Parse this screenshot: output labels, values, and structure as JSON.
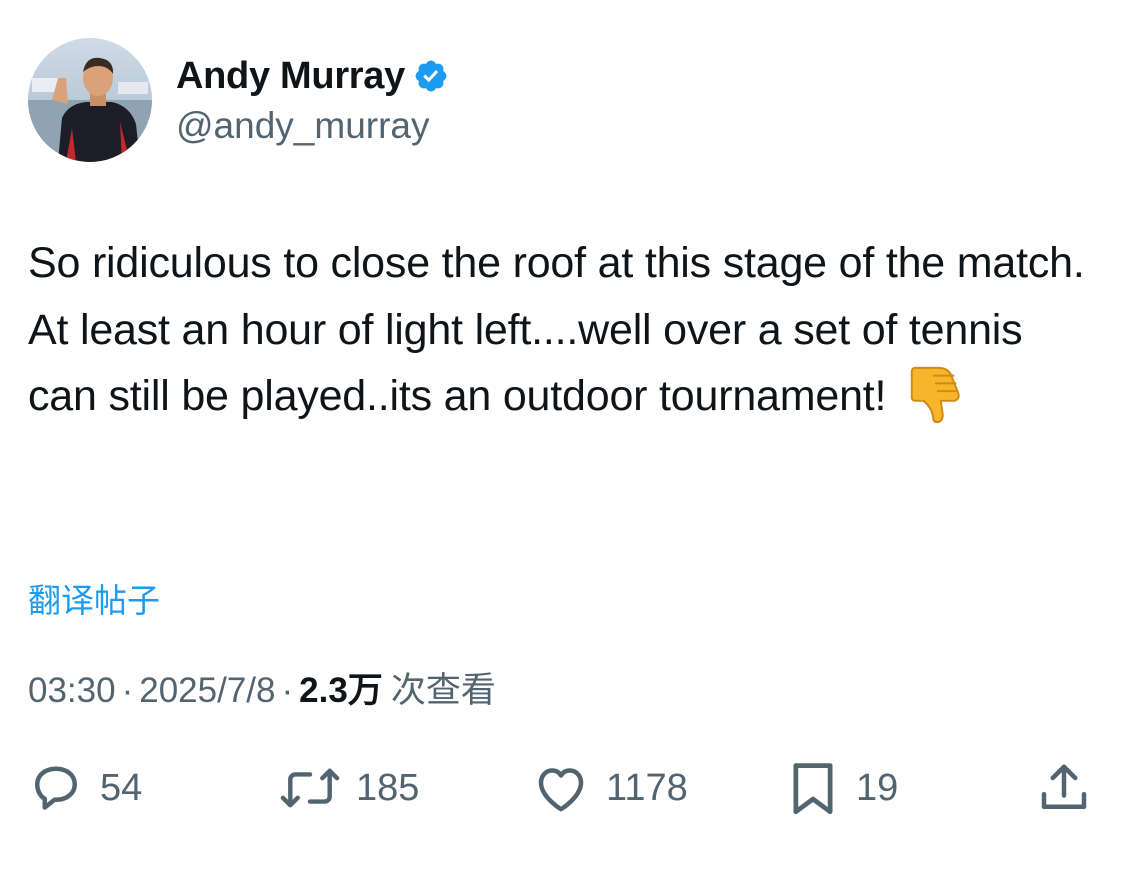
{
  "user": {
    "display_name": "Andy Murray",
    "handle": "@andy_murray",
    "verified_color": "#1d9bf0"
  },
  "tweet": {
    "text": "So ridiculous to close the roof at this stage of the match. At least an hour of light left....well over a set of tennis can still be played..its an outdoor tournament!",
    "emoji": "thumbs-down"
  },
  "translate_label": "翻译帖子",
  "meta": {
    "time": "03:30",
    "date": "2025/7/8",
    "views": "2.3万",
    "views_label": "次查看",
    "separator": "·"
  },
  "actions": {
    "replies": "54",
    "retweets": "185",
    "likes": "1178",
    "bookmarks": "19"
  },
  "colors": {
    "text": "#0f1419",
    "secondary": "#536471",
    "link": "#1d9bf0"
  },
  "icons": [
    "verified-badge-icon",
    "thumbs-down-icon",
    "reply-icon",
    "retweet-icon",
    "like-icon",
    "bookmark-icon",
    "share-icon"
  ]
}
